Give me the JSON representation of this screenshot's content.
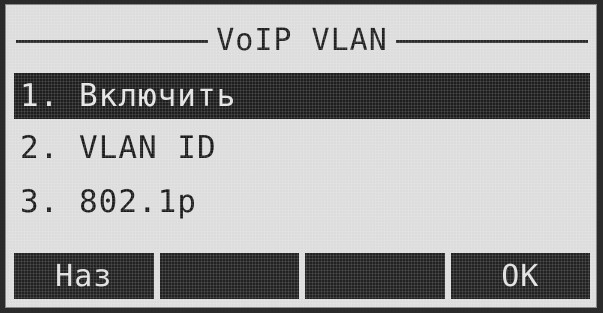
{
  "screen": {
    "title": "VoIP VLAN"
  },
  "menu": {
    "items": [
      {
        "label": "1. Включить",
        "selected": true
      },
      {
        "label": "2. VLAN ID",
        "selected": false
      },
      {
        "label": "3. 802.1p",
        "selected": false
      }
    ]
  },
  "softkeys": {
    "key1": "Наз",
    "key2": "",
    "key3": "",
    "key4": "OK"
  },
  "colors": {
    "lcd_background": "#dcdcdc",
    "lcd_foreground": "#1a1a1a",
    "highlight_background": "#1e1e1e",
    "highlight_foreground": "#e4e4e4"
  }
}
